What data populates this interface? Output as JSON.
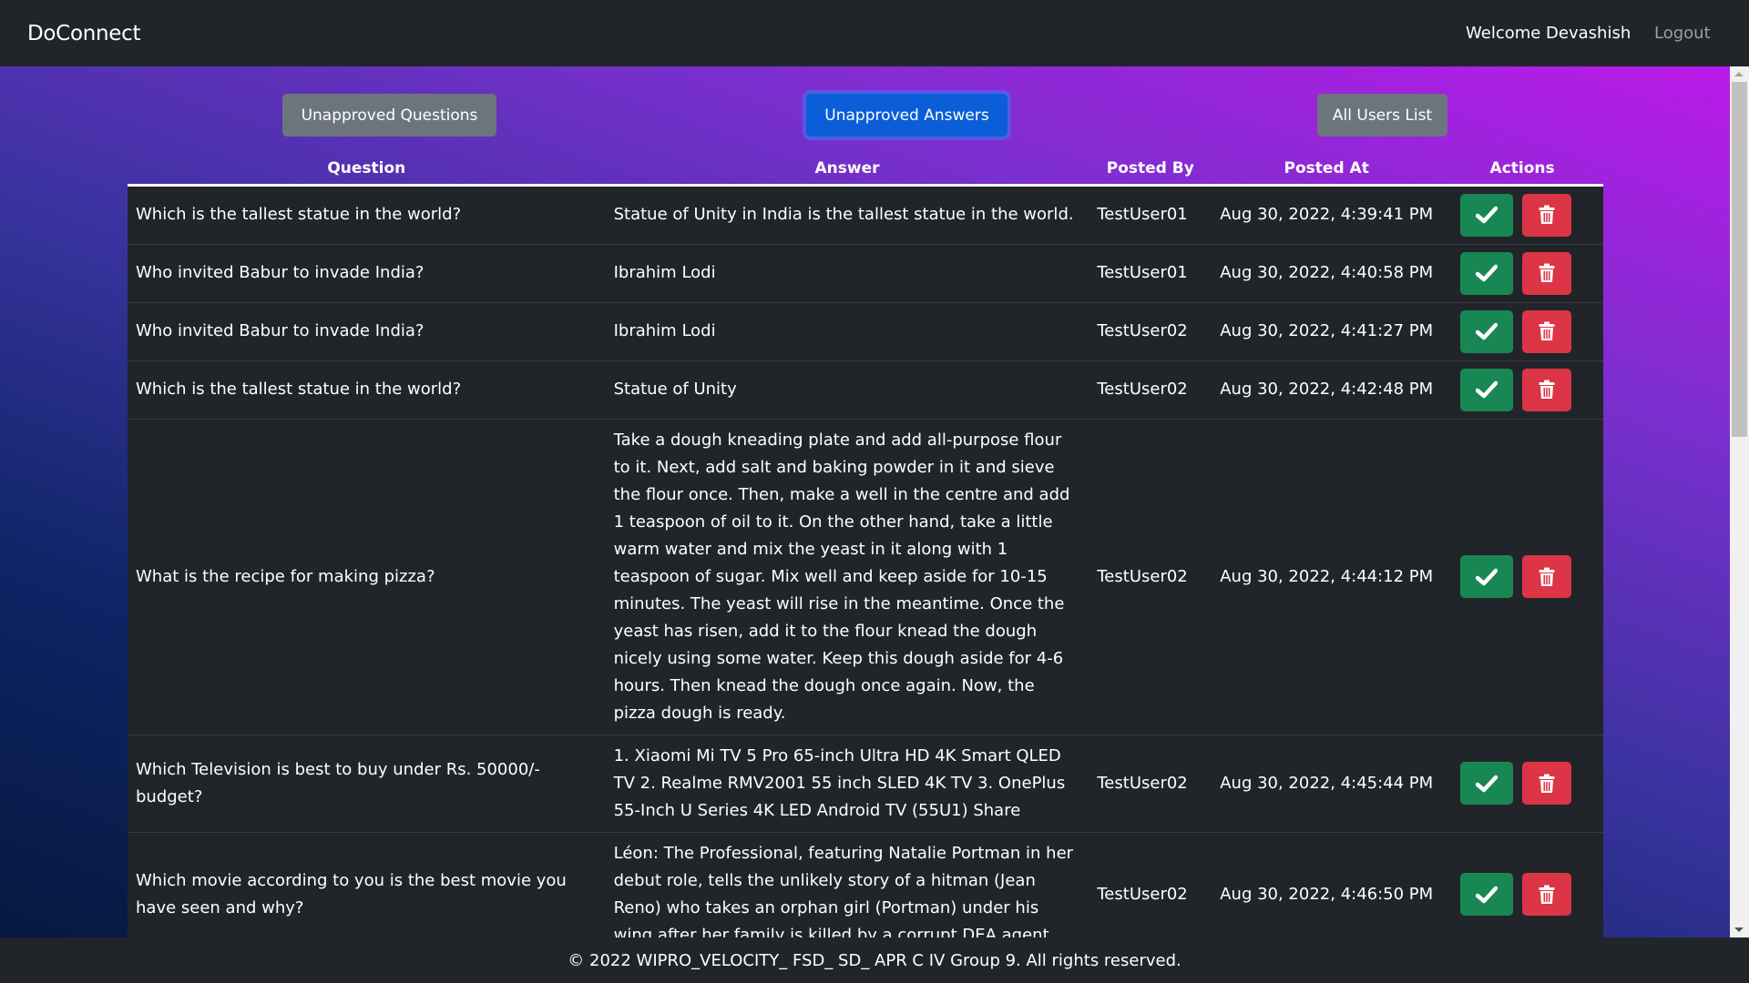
{
  "navbar": {
    "brand": "DoConnect",
    "welcome": "Welcome Devashish",
    "logout": "Logout"
  },
  "tabs": [
    {
      "label": "Unapproved Questions",
      "active": false
    },
    {
      "label": "Unapproved Answers",
      "active": true
    },
    {
      "label": "All Users List",
      "active": false
    }
  ],
  "table": {
    "headers": [
      "Question",
      "Answer",
      "Posted By",
      "Posted At",
      "Actions"
    ],
    "rows": [
      {
        "question": "Which is the tallest statue in the world?",
        "answer": "Statue of Unity in India is the tallest statue in the world.",
        "posted_by": "TestUser01",
        "posted_at": "Aug 30, 2022, 4:39:41 PM"
      },
      {
        "question": "Who invited Babur to invade India?",
        "answer": "Ibrahim Lodi",
        "posted_by": "TestUser01",
        "posted_at": "Aug 30, 2022, 4:40:58 PM"
      },
      {
        "question": "Who invited Babur to invade India?",
        "answer": "Ibrahim Lodi",
        "posted_by": "TestUser02",
        "posted_at": "Aug 30, 2022, 4:41:27 PM"
      },
      {
        "question": "Which is the tallest statue in the world?",
        "answer": "Statue of Unity",
        "posted_by": "TestUser02",
        "posted_at": "Aug 30, 2022, 4:42:48 PM"
      },
      {
        "question": "What is the recipe for making pizza?",
        "answer": "Take a dough kneading plate and add all-purpose flour to it. Next, add salt and baking powder in it and sieve the flour once. Then, make a well in the centre and add 1 teaspoon of oil to it. On the other hand, take a little warm water and mix the yeast in it along with 1 teaspoon of sugar. Mix well and keep aside for 10-15 minutes. The yeast will rise in the meantime. Once the yeast has risen, add it to the flour knead the dough nicely using some water. Keep this dough aside for 4-6 hours. Then knead the dough once again. Now, the pizza dough is ready.",
        "posted_by": "TestUser02",
        "posted_at": "Aug 30, 2022, 4:44:12 PM"
      },
      {
        "question": "Which Television is best to buy under Rs. 50000/- budget?",
        "answer": "1. Xiaomi Mi TV 5 Pro 65-inch Ultra HD 4K Smart QLED TV 2. Realme RMV2001 55 inch SLED 4K TV 3. OnePlus 55-Inch U Series 4K LED Android TV (55U1) Share",
        "posted_by": "TestUser02",
        "posted_at": "Aug 30, 2022, 4:45:44 PM"
      },
      {
        "question": "Which movie according to you is the best movie you have seen and why?",
        "answer": "Léon: The Professional, featuring Natalie Portman in her debut role, tells the unlikely story of a hitman (Jean Reno) who takes an orphan girl (Portman) under his wing after her family is killed by a corrupt DEA agent.",
        "posted_by": "TestUser02",
        "posted_at": "Aug 30, 2022, 4:46:50 PM"
      }
    ],
    "actions": {
      "approve_icon": "check-icon",
      "delete_icon": "trash-icon"
    }
  },
  "footer": {
    "text": "© 2022 WIPRO_VELOCITY_ FSD_ SD_ APR C IV Group 9. All rights reserved."
  },
  "colors": {
    "navbar_bg": "#212529",
    "primary": "#0b5ed7",
    "secondary": "#6c757d",
    "success": "#198754",
    "danger": "#dc3545"
  }
}
